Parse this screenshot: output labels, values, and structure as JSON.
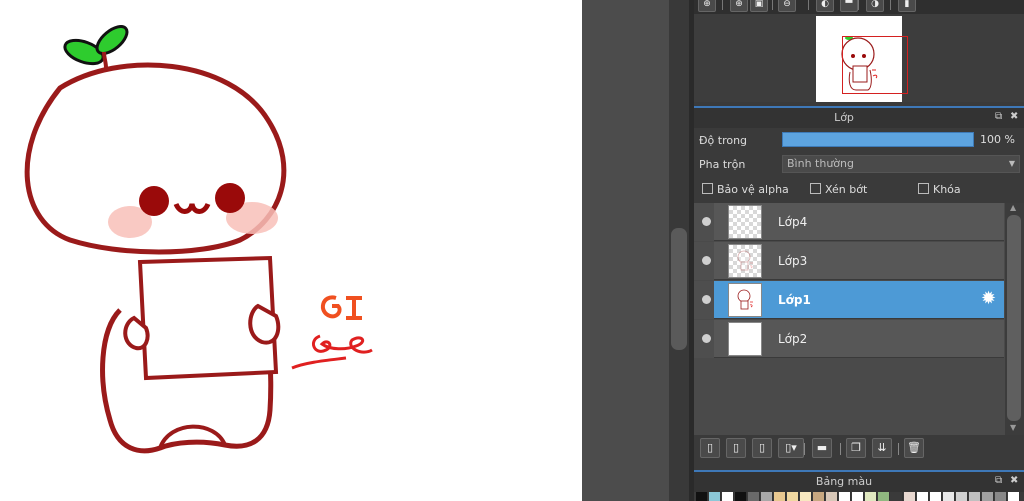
{
  "nav_toolbar": {
    "buttons": [
      {
        "name": "zoom-in-button",
        "glyph": "⊕"
      },
      {
        "name": "zoom-fit-button",
        "glyph": "⊕"
      },
      {
        "name": "fit-window-button",
        "glyph": "▣"
      },
      {
        "name": "zoom-out-button",
        "glyph": "⊖"
      },
      {
        "name": "rotate-left-button",
        "glyph": "◐"
      },
      {
        "name": "flip-button",
        "glyph": "▀"
      },
      {
        "name": "rotate-right-button",
        "glyph": "◑"
      },
      {
        "name": "reset-view-button",
        "glyph": "▮"
      }
    ]
  },
  "layer_panel": {
    "title": "Lớp",
    "opacity_label": "Độ trong",
    "opacity_value": "100 %",
    "opacity_fraction": 1.0,
    "blend_label": "Pha trộn",
    "blend_value": "Bình thường",
    "protect_alpha_label": "Bảo vệ alpha",
    "clipping_label": "Xén bớt",
    "lock_label": "Khóa",
    "layers": [
      {
        "name": "Lớp4",
        "selected": false,
        "thumb": "checker"
      },
      {
        "name": "Lớp3",
        "selected": false,
        "thumb": "checker-drawing"
      },
      {
        "name": "Lớp1",
        "selected": true,
        "thumb": "drawing"
      },
      {
        "name": "Lớp2",
        "selected": false,
        "thumb": "white"
      }
    ]
  },
  "layer_toolbar": {
    "buttons": [
      {
        "name": "new-layer-button",
        "glyph": "▯"
      },
      {
        "name": "new-halftone-layer-button",
        "glyph": "▯"
      },
      {
        "name": "new-8bit-layer-button",
        "glyph": "▯"
      },
      {
        "name": "new-layer-menu-button",
        "glyph": "▯▾"
      },
      {
        "name": "new-folder-button",
        "glyph": "▬"
      },
      {
        "name": "duplicate-layer-button",
        "glyph": "❐"
      },
      {
        "name": "merge-down-button",
        "glyph": "⇊"
      },
      {
        "name": "delete-layer-button",
        "glyph": "🗑"
      }
    ]
  },
  "palette_panel": {
    "title": "Bảng màu",
    "swatches": [
      "#111111",
      "#8cc8d8",
      "#ffffff",
      "#111111",
      "#6a6a6a",
      "#a8a8a8",
      "#e8c890",
      "#f0d8a0",
      "#f8e8c0",
      "#c8a880",
      "#d8c8b8",
      "#ffffff",
      "#ffffff",
      "#e0e8c0",
      "#90b880",
      "#3a3a3a",
      "#e8d8d0",
      "#ffffff",
      "#ffffff",
      "#e8e8e8",
      "#d0d0d0",
      "#c0c0c0",
      "#a0a0a0",
      "#888888",
      "#ffffff"
    ]
  },
  "colors": {
    "accent": "#4d9ad6",
    "panel_bg": "#3a3a3a",
    "header_accent": "#3e78b8"
  }
}
